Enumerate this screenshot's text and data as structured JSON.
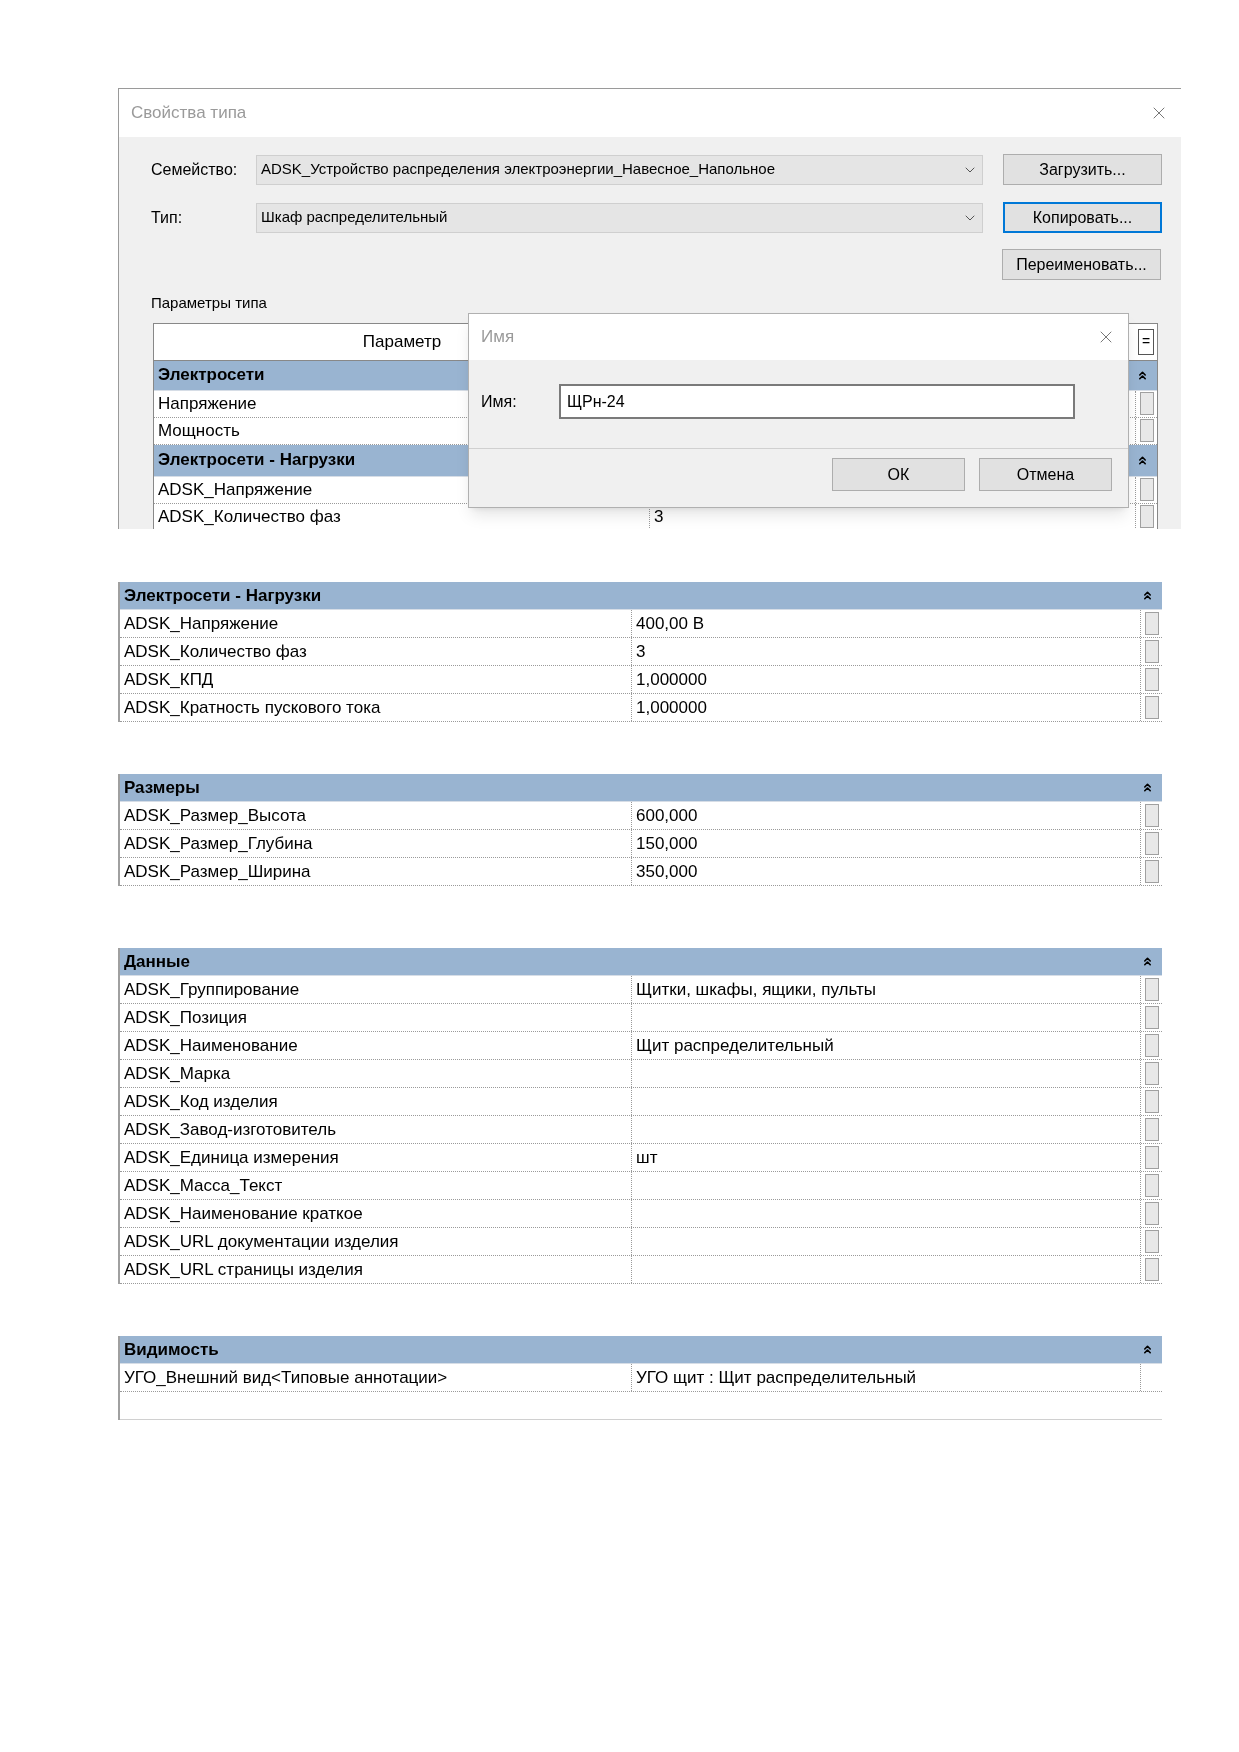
{
  "type_properties_dialog": {
    "title": "Свойства типа",
    "family": {
      "label": "Семейство:",
      "value": "ADSK_Устройство распределения электроэнергии_Навесное_Напольное"
    },
    "type": {
      "label": "Тип:",
      "value": "Шкаф распределительный"
    },
    "buttons": [
      {
        "label": "Загрузить...",
        "focused": false
      },
      {
        "label": "Копировать...",
        "focused": true
      },
      {
        "label": "Переименовать...",
        "focused": false
      }
    ],
    "params_label": "Параметры типа",
    "table": {
      "column_header": "Параметр",
      "header_button": "=",
      "groups": [
        {
          "title": "Электросети",
          "rows": [
            {
              "name": "Напряжение"
            },
            {
              "name": "Мощность"
            }
          ]
        },
        {
          "title": "Электросети - Нагрузки",
          "rows": [
            {
              "name": "ADSK_Напряжение"
            },
            {
              "name": "ADSK_Количество фаз",
              "value": "3"
            }
          ]
        }
      ]
    }
  },
  "name_dialog": {
    "title": "Имя",
    "label": "Имя:",
    "value": "ЩРн-24",
    "buttons": [
      "ОК",
      "Отмена"
    ]
  },
  "sections": [
    {
      "title": "Электросети - Нагрузки",
      "rows": [
        {
          "name": "ADSK_Напряжение",
          "value": "400,00 В"
        },
        {
          "name": "ADSK_Количество фаз",
          "value": "3"
        },
        {
          "name": "ADSK_КПД",
          "value": "1,000000"
        },
        {
          "name": "ADSK_Кратность пускового тока",
          "value": "1,000000"
        }
      ]
    },
    {
      "title": "Размеры",
      "rows": [
        {
          "name": "ADSK_Размер_Высота",
          "value": "600,000"
        },
        {
          "name": "ADSK_Размер_Глубина",
          "value": "150,000"
        },
        {
          "name": "ADSK_Размер_Ширина",
          "value": "350,000"
        }
      ]
    },
    {
      "title": "Данные",
      "rows": [
        {
          "name": "ADSK_Группирование",
          "value": "Щитки, шкафы, ящики, пульты"
        },
        {
          "name": "ADSK_Позиция"
        },
        {
          "name": "ADSK_Наименование",
          "value": "Щит распределительный"
        },
        {
          "name": "ADSK_Марка"
        },
        {
          "name": "ADSK_Код изделия"
        },
        {
          "name": "ADSK_Завод-изготовитель"
        },
        {
          "name": "ADSK_Единица измерения",
          "value": "шт"
        },
        {
          "name": "ADSK_Масса_Текст"
        },
        {
          "name": "ADSK_Наименование краткое"
        },
        {
          "name": "ADSK_URL документации изделия"
        },
        {
          "name": "ADSK_URL страницы изделия"
        }
      ]
    },
    {
      "title": "Видимость",
      "rows": [
        {
          "name": "УГО_Внешний вид<Типовые аннотации>",
          "value": "УГО щит : Щит распределительный",
          "param_button": false
        }
      ],
      "trailing_blank": true
    }
  ]
}
